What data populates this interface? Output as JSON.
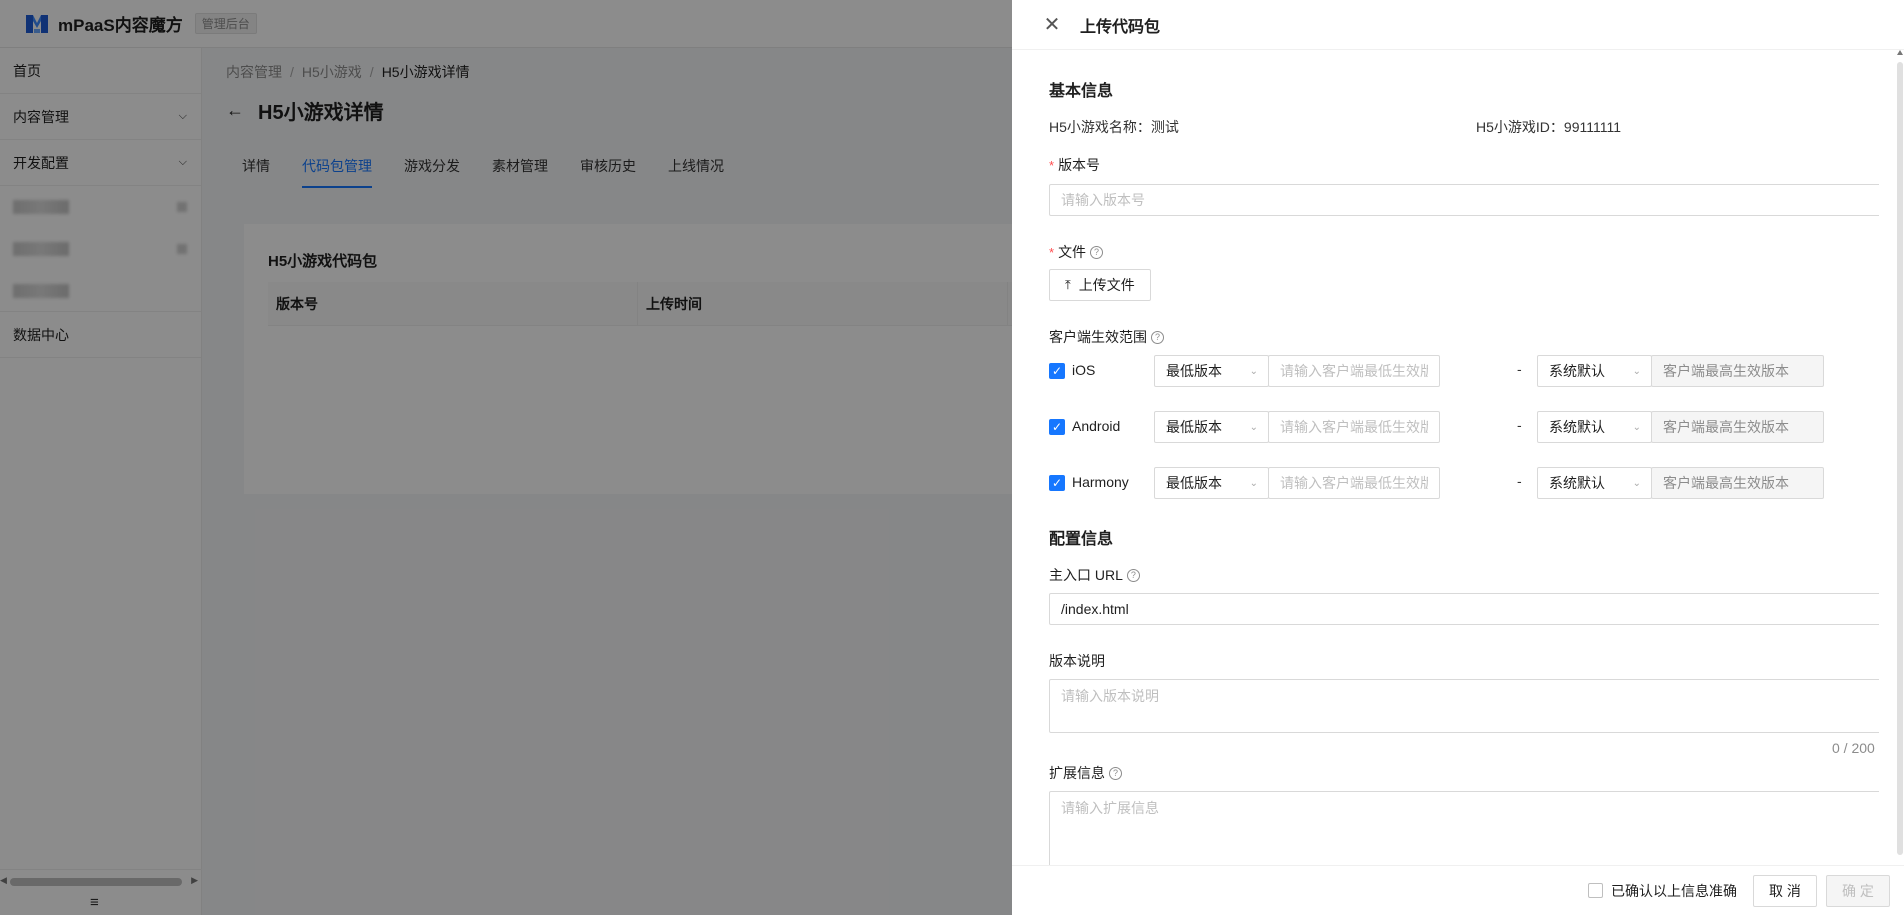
{
  "app": {
    "brand": "mPaaS内容魔方",
    "badge": "管理后台"
  },
  "sidebar": {
    "items": [
      {
        "label": "首页"
      },
      {
        "label": "内容管理",
        "chevron": "⌄"
      },
      {
        "label": "开发配置",
        "chevron": "⌄"
      },
      {
        "label": "数据中心"
      }
    ],
    "collapse_icon": "≡"
  },
  "breadcrumb": {
    "items": [
      "内容管理",
      "H5小游戏"
    ],
    "current": "H5小游戏详情",
    "separator": "/"
  },
  "page": {
    "title": "H5小游戏详情",
    "tabs": [
      "详情",
      "代码包管理",
      "游戏分发",
      "素材管理",
      "审核历史",
      "上线情况"
    ],
    "active_tab": "代码包管理"
  },
  "card": {
    "title": "H5小游戏代码包",
    "columns": [
      "版本号",
      "上传时间"
    ]
  },
  "drawer": {
    "title": "上传代码包",
    "basic_section": "基本信息",
    "game_name_label": "H5小游戏名称：",
    "game_name": "测试",
    "game_id_label": "H5小游戏ID：",
    "game_id": "99111111",
    "version_label": "版本号",
    "version_placeholder": "请输入版本号",
    "file_label": "文件",
    "upload_button": "上传文件",
    "client_range_label": "客户端生效范围",
    "platforms": [
      {
        "name": "iOS",
        "checked": true,
        "min_select": "最低版本",
        "min_placeholder": "请输入客户端最低生效版本",
        "max_select": "系统默认",
        "max_placeholder": "客户端最高生效版本"
      },
      {
        "name": "Android",
        "checked": true,
        "min_select": "最低版本",
        "min_placeholder": "请输入客户端最低生效版本",
        "max_select": "系统默认",
        "max_placeholder": "客户端最高生效版本"
      },
      {
        "name": "Harmony",
        "checked": true,
        "min_select": "最低版本",
        "min_placeholder": "请输入客户端最低生效版本",
        "max_select": "系统默认",
        "max_placeholder": "客户端最高生效版本"
      }
    ],
    "range_dash": "-",
    "config_section": "配置信息",
    "entry_url_label": "主入口 URL",
    "entry_url_value": "/index.html",
    "version_desc_label": "版本说明",
    "version_desc_placeholder": "请输入版本说明",
    "version_desc_counter": "0 / 200",
    "ext_label": "扩展信息",
    "ext_placeholder": "请输入扩展信息"
  },
  "footer": {
    "confirm_label": "已确认以上信息准确",
    "cancel": "取 消",
    "ok": "确 定"
  }
}
